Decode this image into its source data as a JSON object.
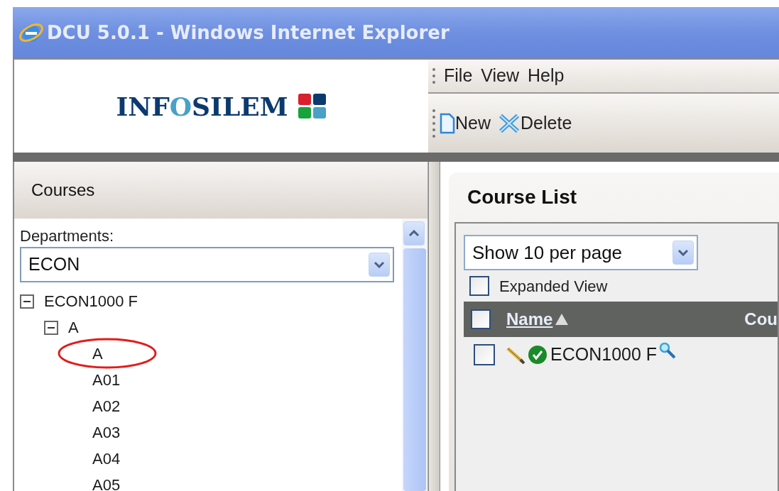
{
  "window": {
    "title": "DCU 5.0.1 - Windows Internet Explorer"
  },
  "logo": {
    "parts": [
      {
        "text": "INF",
        "accent": false
      },
      {
        "text": "O",
        "accent": true
      },
      {
        "text": "SILEM",
        "accent": false
      }
    ]
  },
  "menu": [
    "File",
    "View",
    "Help"
  ],
  "toolbar": [
    {
      "kind": "new",
      "label": "New"
    },
    {
      "kind": "delete",
      "label": "Delete"
    }
  ],
  "sidebar": {
    "title": "Courses",
    "department_label": "Departments:",
    "department": "ECON",
    "tree": [
      {
        "label": "ECON1000 F",
        "expanded": true,
        "children": [
          {
            "label": "A",
            "expanded": true,
            "children": [
              {
                "label": "A",
                "circled": true
              },
              {
                "label": "A01",
                "circled": false
              },
              {
                "label": "A02",
                "circled": false
              },
              {
                "label": "A03",
                "circled": false
              },
              {
                "label": "A04",
                "circled": false
              },
              {
                "label": "A05",
                "circled": false
              }
            ]
          }
        ]
      }
    ]
  },
  "course_list": {
    "title": "Course List",
    "page_size": "Show 10 per page",
    "expanded_view": {
      "label": "Expanded View",
      "checked": false
    },
    "columns": [
      {
        "label": "Name",
        "sorted": true
      },
      {
        "label": "Cou",
        "sorted": false
      }
    ],
    "rows": [
      {
        "checked": false,
        "approved": true,
        "name": "ECON1000 F"
      }
    ]
  }
}
